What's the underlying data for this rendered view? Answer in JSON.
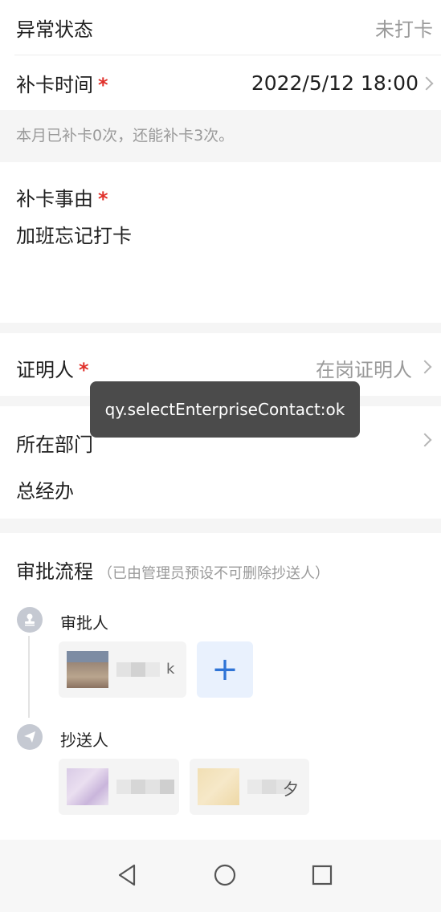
{
  "form": {
    "abnormal_status": {
      "label": "异常状态",
      "value": "未打卡"
    },
    "makeup_time": {
      "label": "补卡时间",
      "required_mark": "*",
      "value": "2022/5/12 18:00"
    },
    "makeup_note": "本月已补卡0次，还能补卡3次。",
    "reason": {
      "label": "补卡事由",
      "required_mark": "*",
      "value": "加班忘记打卡"
    },
    "witness": {
      "label": "证明人",
      "required_mark": "*",
      "placeholder": "在岗证明人"
    },
    "department": {
      "label": "所在部门",
      "value": "总经办"
    }
  },
  "toast": {
    "text": "qy.selectEnterpriseContact:ok"
  },
  "approval": {
    "title": "审批流程",
    "note": "（已由管理员预设不可删除抄送人）",
    "approver_label": "审批人",
    "cc_label": "抄送人",
    "approver_chip_suffix": "k",
    "cc_chip_suffix": "夕",
    "add_symbol": "+"
  },
  "icons": {
    "approver": "stamp-icon",
    "cc": "send-icon",
    "nav_back": "back-triangle-icon",
    "nav_home": "home-circle-icon",
    "nav_recent": "recent-square-icon"
  }
}
